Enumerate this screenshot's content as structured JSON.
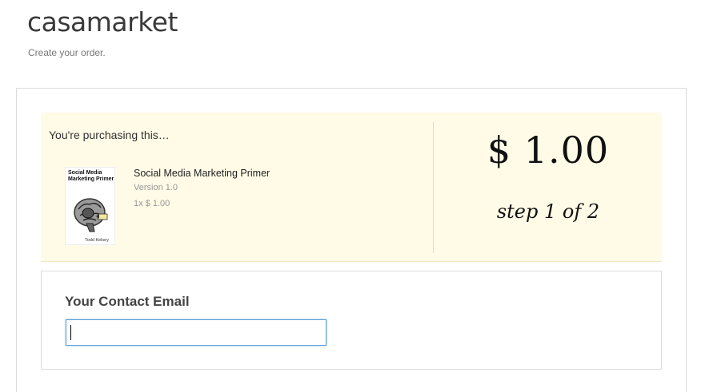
{
  "site": {
    "title": "casamarket",
    "tagline": "Create your order."
  },
  "summary": {
    "heading": "You're purchasing this…",
    "product": {
      "cover_title": "Social Media Marketing Primer",
      "cover_author": "Todd Kelsey",
      "name": "Social Media Marketing Primer",
      "version": "Version 1.0",
      "quantity_price": "1x $ 1.00"
    },
    "price": "$ 1.00",
    "step": "step 1 of 2"
  },
  "contact": {
    "label": "Your Contact Email",
    "email_value": "",
    "email_placeholder": ""
  },
  "colors": {
    "summary_bg": "#fffbe6",
    "input_focus_border": "#5b9dd9"
  }
}
